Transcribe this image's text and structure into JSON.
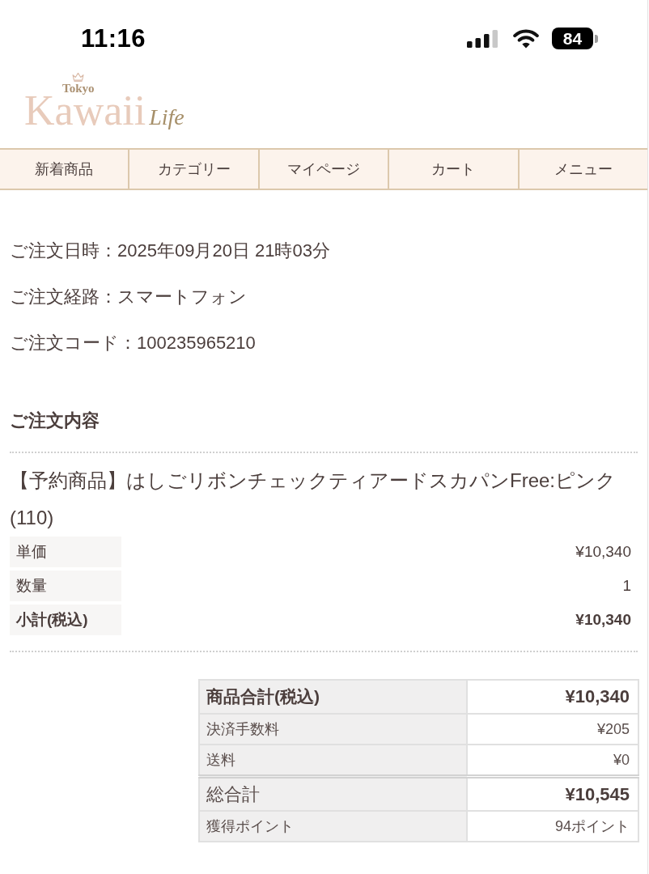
{
  "status_bar": {
    "time": "11:16",
    "battery": "84"
  },
  "logo": {
    "small": "Tokyo",
    "main": "Kawaii",
    "sub": "Life"
  },
  "nav": [
    {
      "label": "新着商品"
    },
    {
      "label": "カテゴリー"
    },
    {
      "label": "マイページ"
    },
    {
      "label": "カート"
    },
    {
      "label": "メニュー"
    }
  ],
  "order_info": [
    "ご注文日時：2025年09月20日 21時03分",
    "ご注文経路：スマートフォン",
    "ご注文コード：100235965210"
  ],
  "section_title": "ご注文内容",
  "items": [
    {
      "name": "【予約商品】はしごリボンチェックティアードスカパンFree:ピンク(110)",
      "details": [
        {
          "kind": "line",
          "label": "単価",
          "value": "¥10,340"
        },
        {
          "kind": "line",
          "label": "数量",
          "value": "1"
        },
        {
          "kind": "total",
          "label": "小計(税込)",
          "value": "¥10,340"
        }
      ]
    }
  ],
  "totals": [
    {
      "kind": "subtotal",
      "label": "商品合計(税込)",
      "value": "¥10,340"
    },
    {
      "kind": "line",
      "label": "決済手数料",
      "value": "¥205"
    },
    {
      "kind": "line",
      "label": "送料",
      "value": "¥0"
    },
    {
      "kind": "grand",
      "label": "総合計",
      "value": "¥10,545"
    },
    {
      "kind": "line",
      "label": "獲得ポイント",
      "value": "94ポイント"
    }
  ]
}
